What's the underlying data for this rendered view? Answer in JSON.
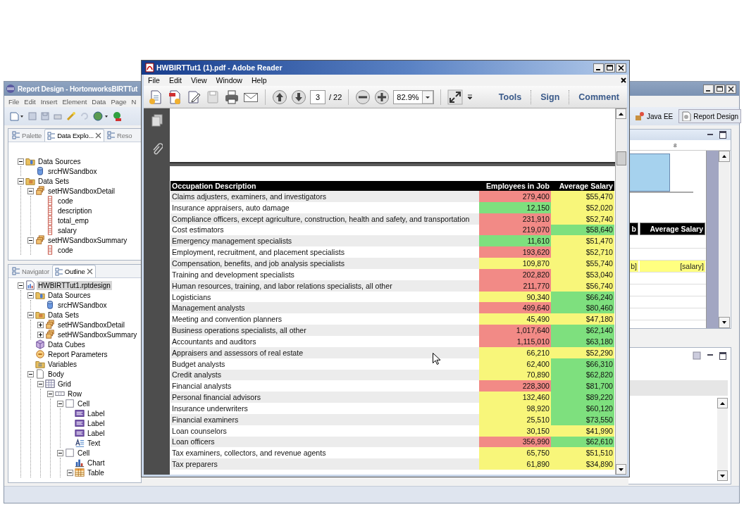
{
  "report_designer": {
    "title": "Report Design - HortonworksBIRTTut",
    "menu": [
      "File",
      "Edit",
      "Insert",
      "Element",
      "Data",
      "Page",
      "N"
    ],
    "explorer_tabs": [
      {
        "label": "Palette",
        "selected": false
      },
      {
        "label": "Data Explo...",
        "selected": true
      },
      {
        "label": "Reso",
        "selected": false
      }
    ],
    "data_explorer": [
      {
        "label": "Data Sources",
        "kind": "sources",
        "expanded": true,
        "selected": false,
        "children": [
          {
            "label": "srcHWSandbox",
            "kind": "source",
            "selected": false
          }
        ]
      },
      {
        "label": "Data Sets",
        "kind": "sets",
        "expanded": true,
        "selected": false,
        "children": [
          {
            "label": "setHWSandboxDetail",
            "kind": "set",
            "expanded": true,
            "selected": false,
            "children": [
              {
                "label": "code",
                "kind": "column",
                "selected": false
              },
              {
                "label": "description",
                "kind": "column",
                "selected": false
              },
              {
                "label": "total_emp",
                "kind": "column",
                "selected": false
              },
              {
                "label": "salary",
                "kind": "column",
                "selected": false
              }
            ]
          },
          {
            "label": "setHWSandboxSummary",
            "kind": "set",
            "expanded": true,
            "selected": false,
            "children": [
              {
                "label": "code",
                "kind": "column",
                "selected": false
              }
            ]
          }
        ]
      }
    ],
    "outline_tabs": [
      {
        "label": "Navigator",
        "selected": false
      },
      {
        "label": "Outline",
        "selected": true
      }
    ],
    "outline": [
      {
        "label": "HWBIRTTut1.rptdesign",
        "kind": "report",
        "expanded": true,
        "selected": true,
        "children": [
          {
            "label": "Data Sources",
            "kind": "sources",
            "expanded": true,
            "selected": false,
            "children": [
              {
                "label": "srcHWSandbox",
                "kind": "source",
                "selected": false
              }
            ]
          },
          {
            "label": "Data Sets",
            "kind": "sets",
            "expanded": true,
            "selected": false,
            "children": [
              {
                "label": "setHWSandboxDetail",
                "kind": "set",
                "expanded": false,
                "selected": false
              },
              {
                "label": "setHWSandboxSummary",
                "kind": "set",
                "expanded": false,
                "selected": false
              }
            ]
          },
          {
            "label": "Data Cubes",
            "kind": "cubes",
            "selected": false
          },
          {
            "label": "Report Parameters",
            "kind": "parameters",
            "selected": false
          },
          {
            "label": "Variables",
            "kind": "variables",
            "selected": false
          },
          {
            "label": "Body",
            "kind": "body",
            "expanded": true,
            "selected": false,
            "children": [
              {
                "label": "Grid",
                "kind": "grid",
                "expanded": true,
                "selected": false,
                "children": [
                  {
                    "label": "Row",
                    "kind": "row",
                    "expanded": true,
                    "selected": false,
                    "children": [
                      {
                        "label": "Cell",
                        "kind": "cell",
                        "expanded": true,
                        "selected": false,
                        "children": [
                          {
                            "label": "Label",
                            "kind": "label",
                            "selected": false
                          },
                          {
                            "label": "Label",
                            "kind": "label",
                            "selected": false
                          },
                          {
                            "label": "Label",
                            "kind": "label",
                            "selected": false
                          },
                          {
                            "label": "Text",
                            "kind": "text",
                            "selected": false
                          }
                        ]
                      },
                      {
                        "label": "Cell",
                        "kind": "cell",
                        "expanded": true,
                        "selected": false,
                        "children": [
                          {
                            "label": "Chart",
                            "kind": "chart",
                            "selected": false
                          },
                          {
                            "label": "Table",
                            "kind": "table",
                            "expanded": true,
                            "selected": false
                          }
                        ]
                      }
                    ]
                  }
                ]
              }
            ]
          }
        ]
      }
    ],
    "perspectives": [
      {
        "label": "Java EE",
        "selected": false
      },
      {
        "label": "Report Design",
        "selected": true
      }
    ],
    "ruler_mark": "8",
    "layout_table": {
      "header": [
        "b",
        "Average Salary"
      ],
      "detail": [
        "b]",
        "[salary]"
      ]
    }
  },
  "reader": {
    "title": "HWBIRTTut1 (1).pdf - Adobe Reader",
    "menu": [
      "File",
      "Edit",
      "View",
      "Window",
      "Help"
    ],
    "page": "3",
    "page_total": "/ 22",
    "zoom": "82.9%",
    "panels": [
      "Tools",
      "Sign",
      "Comment"
    ],
    "table": {
      "columns": [
        "Occupation Description",
        "Employees in Job",
        "Average Salary"
      ],
      "rows": [
        {
          "description": "Claims adjusters, examiners, and investigators",
          "employees": {
            "value": "279,400",
            "color": "#f28a86"
          },
          "salary": {
            "value": "$55,470",
            "color": "#f8f67a"
          }
        },
        {
          "description": "Insurance appraisers, auto damage",
          "employees": {
            "value": "12,150",
            "color": "#7ee07e"
          },
          "salary": {
            "value": "$52,020",
            "color": "#f8f67a"
          }
        },
        {
          "description": "Compliance officers, except agriculture, construction, health and safety, and transportation",
          "employees": {
            "value": "231,910",
            "color": "#f28a86"
          },
          "salary": {
            "value": "$52,740",
            "color": "#f8f67a"
          }
        },
        {
          "description": "Cost estimators",
          "employees": {
            "value": "219,070",
            "color": "#f28a86"
          },
          "salary": {
            "value": "$58,640",
            "color": "#7ee07e"
          }
        },
        {
          "description": "Emergency management specialists",
          "employees": {
            "value": "11,610",
            "color": "#7ee07e"
          },
          "salary": {
            "value": "$51,470",
            "color": "#f8f67a"
          }
        },
        {
          "description": "Employment, recruitment, and placement specialists",
          "employees": {
            "value": "193,620",
            "color": "#f28a86"
          },
          "salary": {
            "value": "$52,710",
            "color": "#f8f67a"
          }
        },
        {
          "description": "Compensation, benefits, and job analysis specialists",
          "employees": {
            "value": "109,870",
            "color": "#f8f67a"
          },
          "salary": {
            "value": "$55,740",
            "color": "#f8f67a"
          }
        },
        {
          "description": "Training and development specialists",
          "employees": {
            "value": "202,820",
            "color": "#f28a86"
          },
          "salary": {
            "value": "$53,040",
            "color": "#f8f67a"
          }
        },
        {
          "description": "Human resources, training, and labor relations specialists, all other",
          "employees": {
            "value": "211,770",
            "color": "#f28a86"
          },
          "salary": {
            "value": "$56,740",
            "color": "#f8f67a"
          }
        },
        {
          "description": "Logisticians",
          "employees": {
            "value": "90,340",
            "color": "#f8f67a"
          },
          "salary": {
            "value": "$66,240",
            "color": "#7ee07e"
          }
        },
        {
          "description": "Management analysts",
          "employees": {
            "value": "499,640",
            "color": "#f28a86"
          },
          "salary": {
            "value": "$80,460",
            "color": "#7ee07e"
          }
        },
        {
          "description": "Meeting and convention planners",
          "employees": {
            "value": "45,490",
            "color": "#f8f67a"
          },
          "salary": {
            "value": "$47,180",
            "color": "#f8f67a"
          }
        },
        {
          "description": "Business operations specialists, all other",
          "employees": {
            "value": "1,017,640",
            "color": "#f28a86"
          },
          "salary": {
            "value": "$62,140",
            "color": "#7ee07e"
          }
        },
        {
          "description": "Accountants and auditors",
          "employees": {
            "value": "1,115,010",
            "color": "#f28a86"
          },
          "salary": {
            "value": "$63,180",
            "color": "#7ee07e"
          }
        },
        {
          "description": "Appraisers and assessors of real estate",
          "employees": {
            "value": "66,210",
            "color": "#f8f67a"
          },
          "salary": {
            "value": "$52,290",
            "color": "#f8f67a"
          }
        },
        {
          "description": "Budget analysts",
          "employees": {
            "value": "62,400",
            "color": "#f8f67a"
          },
          "salary": {
            "value": "$66,310",
            "color": "#7ee07e"
          }
        },
        {
          "description": "Credit analysts",
          "employees": {
            "value": "70,890",
            "color": "#f8f67a"
          },
          "salary": {
            "value": "$62,820",
            "color": "#7ee07e"
          }
        },
        {
          "description": "Financial analysts",
          "employees": {
            "value": "228,300",
            "color": "#f28a86"
          },
          "salary": {
            "value": "$81,700",
            "color": "#7ee07e"
          }
        },
        {
          "description": "Personal financial advisors",
          "employees": {
            "value": "132,460",
            "color": "#f8f67a"
          },
          "salary": {
            "value": "$89,220",
            "color": "#7ee07e"
          }
        },
        {
          "description": "Insurance underwriters",
          "employees": {
            "value": "98,920",
            "color": "#f8f67a"
          },
          "salary": {
            "value": "$60,120",
            "color": "#7ee07e"
          }
        },
        {
          "description": "Financial examiners",
          "employees": {
            "value": "25,510",
            "color": "#f8f67a"
          },
          "salary": {
            "value": "$73,550",
            "color": "#7ee07e"
          }
        },
        {
          "description": "Loan counselors",
          "employees": {
            "value": "30,150",
            "color": "#f8f67a"
          },
          "salary": {
            "value": "$41,990",
            "color": "#f8f67a"
          }
        },
        {
          "description": "Loan officers",
          "employees": {
            "value": "356,990",
            "color": "#f28a86"
          },
          "salary": {
            "value": "$62,610",
            "color": "#7ee07e"
          }
        },
        {
          "description": "Tax examiners, collectors, and revenue agents",
          "employees": {
            "value": "65,750",
            "color": "#f8f67a"
          },
          "salary": {
            "value": "$51,510",
            "color": "#f8f67a"
          }
        },
        {
          "description": "Tax preparers",
          "employees": {
            "value": "61,890",
            "color": "#f8f67a"
          },
          "salary": {
            "value": "$34,890",
            "color": "#f8f67a"
          }
        }
      ]
    }
  }
}
